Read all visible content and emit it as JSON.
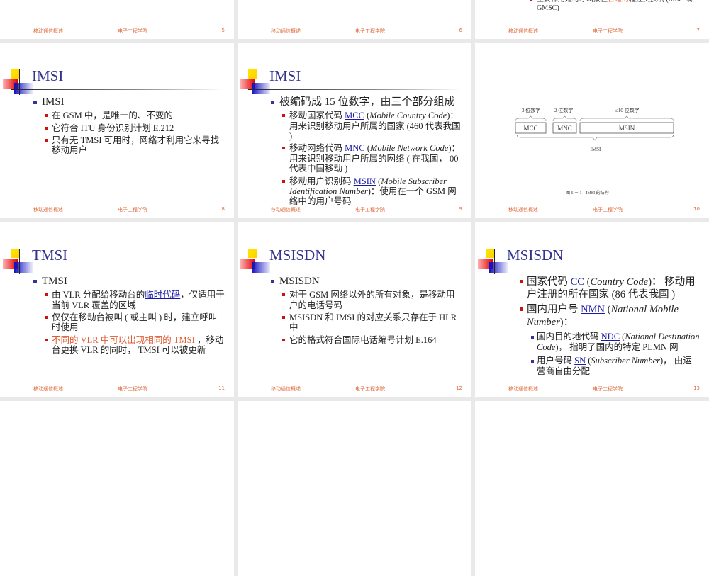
{
  "footer": {
    "left": "移动通信概述",
    "center": "电子工程学院"
  },
  "slides": [
    {
      "num": "5"
    },
    {
      "num": "6"
    },
    {
      "num": "7",
      "partial": [
        {
          "t": "主要作用是将呼叫接往"
        },
        {
          "t": "合适的",
          "s": "red"
        },
        {
          "t": "程控交换机 (MSC 或 GMSC)"
        }
      ]
    },
    {
      "num": "8",
      "title": "IMSI",
      "bullets": [
        {
          "l": "b1",
          "runs": [
            {
              "t": "IMSI"
            }
          ]
        },
        {
          "l": "b2",
          "runs": [
            {
              "t": "在 GSM 中，是唯一的、不变的"
            }
          ]
        },
        {
          "l": "b2",
          "runs": [
            {
              "t": "它符合 ITU 身份识别计划 E.212"
            }
          ]
        },
        {
          "l": "b2",
          "runs": [
            {
              "t": "只有无 TMSI 可用时，网络才利用它来寻找移动用户"
            }
          ]
        }
      ]
    },
    {
      "num": "9",
      "title": "IMSI",
      "bullets": [
        {
          "l": "b1",
          "runs": [
            {
              "t": "被编码成 15 位数字，由三个部分组成"
            }
          ]
        },
        {
          "l": "b2",
          "runs": [
            {
              "t": "移动国家代码 "
            },
            {
              "t": "MCC",
              "s": "link"
            },
            {
              "t": " ("
            },
            {
              "t": "Mobile Country Code",
              "s": "i"
            },
            {
              "t": ")：用来识别移动用户所属的国家 (460 代表我国 )"
            }
          ]
        },
        {
          "l": "b2",
          "runs": [
            {
              "t": "移动网络代码 "
            },
            {
              "t": "MNC",
              "s": "link"
            },
            {
              "t": " ("
            },
            {
              "t": "Mobile Network Code",
              "s": "i"
            },
            {
              "t": ")：用来识别移动用户所属的网络 ( 在我国， 00 代表中国移动 )"
            }
          ]
        },
        {
          "l": "b2",
          "runs": [
            {
              "t": "移动用户识别码 "
            },
            {
              "t": "MSIN",
              "s": "link"
            },
            {
              "t": " ("
            },
            {
              "t": "Mobile Subscriber Identification Number",
              "s": "i"
            },
            {
              "t": ")：使用在一个 GSM 网络中的用户号码"
            }
          ]
        }
      ]
    },
    {
      "num": "10",
      "diagram": {
        "labels": [
          "3 位数字",
          "2 位数字",
          "≤10 位数字"
        ],
        "boxes": [
          "MCC",
          "MNC",
          "MSIN"
        ],
        "total": "IMSI",
        "caption": "图 6 － 1　IMSI 的结构"
      }
    },
    {
      "num": "11",
      "title": "TMSI",
      "bullets": [
        {
          "l": "b1",
          "runs": [
            {
              "t": "TMSI"
            }
          ]
        },
        {
          "l": "b2",
          "runs": [
            {
              "t": "由 VLR 分配给移动台的"
            },
            {
              "t": "临时代码",
              "s": "link"
            },
            {
              "t": "，仅适用于当前 VLR 覆盖的区域"
            }
          ]
        },
        {
          "l": "b2",
          "runs": [
            {
              "t": "仅仅在移动台被叫 ( 或主叫 ) 时，建立呼叫时使用"
            }
          ]
        },
        {
          "l": "b2",
          "runs": [
            {
              "t": "不同的 VLR 中可以出现相同的 TMSI",
              "s": "red"
            },
            {
              "t": " ，移动台更换 VLR 的同时， TMSI 可以被更新"
            }
          ]
        }
      ]
    },
    {
      "num": "12",
      "title": "MSISDN",
      "bullets": [
        {
          "l": "b1",
          "runs": [
            {
              "t": "MSISDN"
            }
          ]
        },
        {
          "l": "b2",
          "runs": [
            {
              "t": "对于 GSM 网络以外的所有对象，是移动用户的电话号码"
            }
          ]
        },
        {
          "l": "b2",
          "runs": [
            {
              "t": "MSISDN 和 IMSI 的对应关系只存在于 HLR 中"
            }
          ]
        },
        {
          "l": "b2",
          "runs": [
            {
              "t": "它的格式符合国际电话编号计划 E.164"
            }
          ]
        }
      ]
    },
    {
      "num": "13",
      "title": "MSISDN",
      "bullets": [
        {
          "l": "b2L",
          "runs": [
            {
              "t": "国家代码 "
            },
            {
              "t": "CC",
              "s": "link"
            },
            {
              "t": " ("
            },
            {
              "t": "Country Code",
              "s": "i"
            },
            {
              "t": ")： 移动用户注册的所在国家 (86 代表我国 )"
            }
          ]
        },
        {
          "l": "b2L",
          "runs": [
            {
              "t": "国内用户号 "
            },
            {
              "t": "NMN",
              "s": "link"
            },
            {
              "t": " ("
            },
            {
              "t": "National Mobile Number",
              "s": "i"
            },
            {
              "t": ")："
            }
          ]
        },
        {
          "l": "b3",
          "runs": [
            {
              "t": "国内目的地代码 "
            },
            {
              "t": "NDC",
              "s": "link"
            },
            {
              "t": " ("
            },
            {
              "t": "National Destination Code",
              "s": "i"
            },
            {
              "t": ")， 指明了国内的特定 PLMN 网"
            }
          ]
        },
        {
          "l": "b3",
          "runs": [
            {
              "t": "用户号码 "
            },
            {
              "t": "SN",
              "s": "link"
            },
            {
              "t": " ("
            },
            {
              "t": "Subscriber Number",
              "s": "i"
            },
            {
              "t": ")， 由运营商自由分配"
            }
          ]
        }
      ]
    },
    {
      "num": ""
    },
    {
      "num": ""
    },
    {
      "num": ""
    }
  ]
}
